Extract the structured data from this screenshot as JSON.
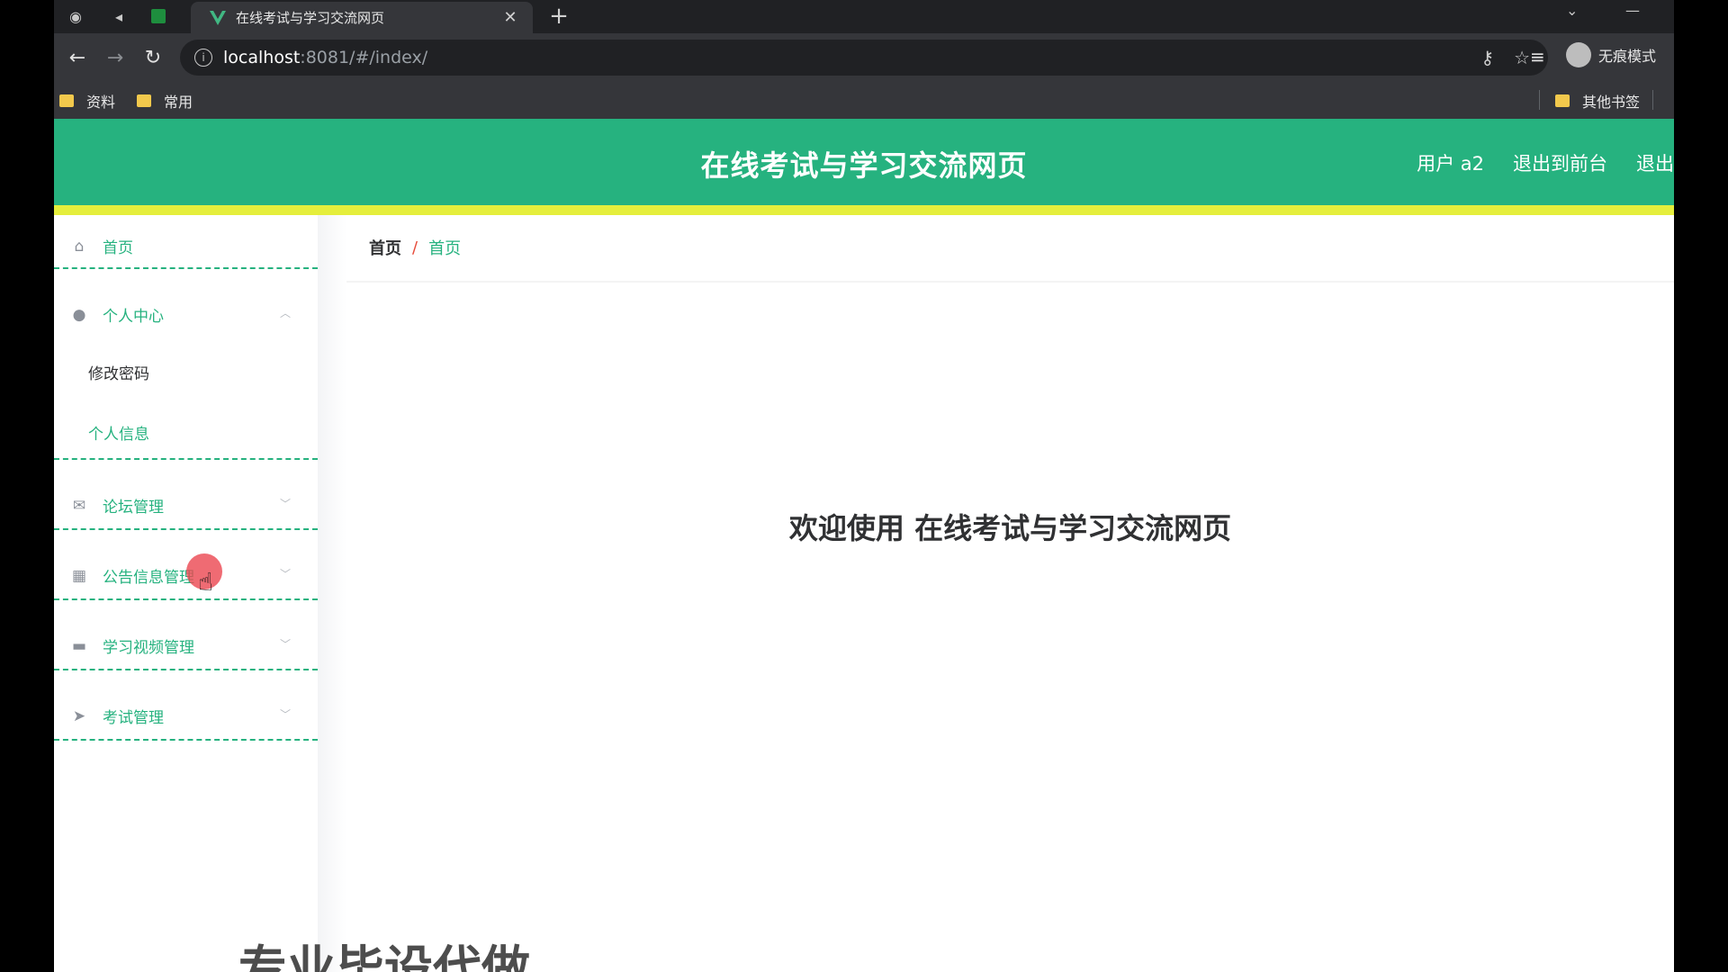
{
  "browser": {
    "tab_title": "在线考试与学习交流网页",
    "url_host": "localhost",
    "url_path": ":8081/#/index/",
    "profile_label": "无痕模式",
    "bookmarks": [
      "资料",
      "常用"
    ],
    "other_bookmarks": "其他书签"
  },
  "header": {
    "title": "在线考试与学习交流网页",
    "user": "用户 a2",
    "to_front": "退出到前台",
    "logout": "退出"
  },
  "sidebar": {
    "home": "首页",
    "personal_center": "个人中心",
    "change_password": "修改密码",
    "personal_info": "个人信息",
    "forum": "论坛管理",
    "notice": "公告信息管理",
    "video": "学习视频管理",
    "exam": "考试管理"
  },
  "breadcrumb": {
    "first": "首页",
    "sep": "/",
    "current": "首页"
  },
  "welcome": "欢迎使用 在线考试与学习交流网页",
  "watermark": "专业毕设代做",
  "colors": {
    "accent": "#26b27f",
    "banner_stripe": "#e5ee3c"
  }
}
